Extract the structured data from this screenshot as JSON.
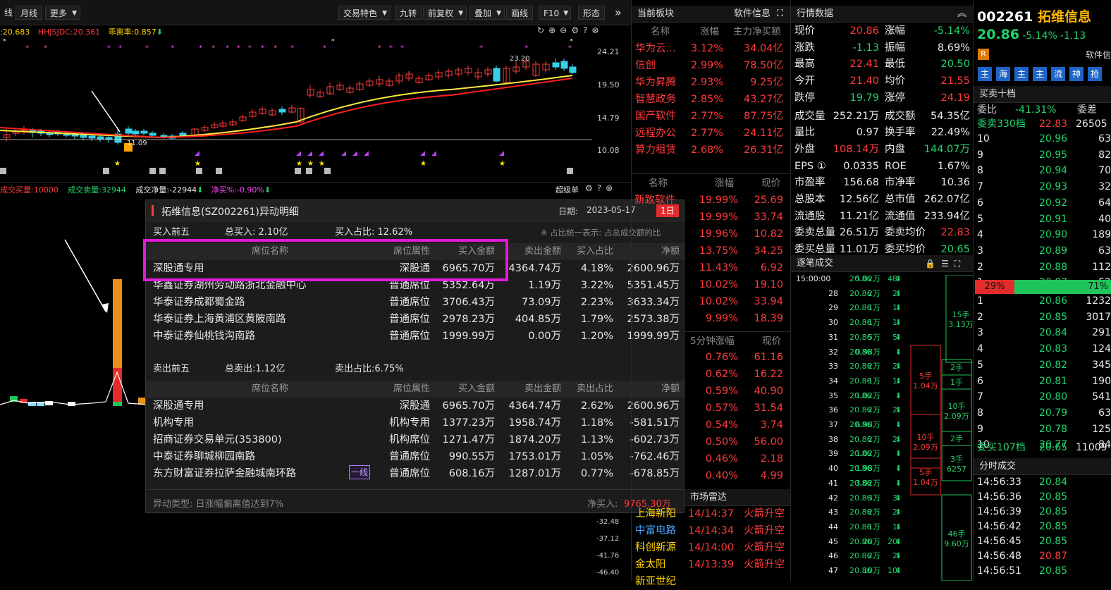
{
  "toolbar": {
    "left": [
      "线",
      "月线",
      "更多"
    ],
    "right": [
      "交易特色",
      "九转",
      "前复权",
      "叠加",
      "画线",
      "F10",
      "形态"
    ]
  },
  "indicators": {
    "main": [
      ":20.683",
      "HHJSJDC:20.361",
      "乖离率:0.857"
    ],
    "vol": [
      "成交买量:10000",
      "成交卖量:32944",
      "成交净量:-22944",
      "净买%:-0.90%"
    ],
    "vol_tag": "超级单"
  },
  "price_axis": [
    "24.21",
    "19.50",
    "14.79",
    "10.08"
  ],
  "chart_labels": {
    "high": "23.20",
    "low": "11.09"
  },
  "lower_axis": [
    "-32.48",
    "-37.12",
    "-41.76",
    "-46.40"
  ],
  "popup": {
    "title": "拓维信息(SZ002261)异动明细",
    "date_label": "日期:",
    "date": "2023-05-17",
    "period": "1日",
    "buy": {
      "section": "买入前五",
      "total": "总买入: 2.10亿",
      "ratio": "买入占比: 12.62%",
      "note": "※ 占比统一表示: 占总成交额的比"
    },
    "buy_head": [
      "席位名称",
      "席位属性",
      "买入金额",
      "卖出金额",
      "买入占比",
      "净额"
    ],
    "buy_rows": [
      [
        "深股通专用",
        "深股通",
        "6965.70万",
        "4364.74万",
        "4.18%",
        "2600.96万"
      ],
      [
        "华鑫证券湖州劳动路浙北金融中心",
        "普通席位",
        "5352.64万",
        "1.19万",
        "3.22%",
        "5351.45万"
      ],
      [
        "华泰证券成都蜀金路",
        "普通席位",
        "3706.43万",
        "73.09万",
        "2.23%",
        "3633.34万"
      ],
      [
        "华泰证券上海黄浦区黄陂南路",
        "普通席位",
        "2978.23万",
        "404.85万",
        "1.79%",
        "2573.38万"
      ],
      [
        "中泰证券仙桃钱沟南路",
        "普通席位",
        "1999.99万",
        "0.00万",
        "1.20%",
        "1999.99万"
      ]
    ],
    "sell": {
      "section": "卖出前五",
      "total": "总卖出:1.12亿",
      "ratio": "卖出占比:6.75%"
    },
    "sell_head": [
      "席位名称",
      "席位属性",
      "买入金额",
      "卖出金额",
      "卖出占比",
      "净额"
    ],
    "sell_rows": [
      [
        "深股通专用",
        "深股通",
        "6965.70万",
        "4364.74万",
        "2.62%",
        "2600.96万"
      ],
      [
        "机构专用",
        "机构专用",
        "1377.23万",
        "1958.74万",
        "1.18%",
        "-581.51万"
      ],
      [
        "招商证券交易单元(353800)",
        "机构席位",
        "1271.47万",
        "1874.20万",
        "1.13%",
        "-602.73万"
      ],
      [
        "中泰证券聊城柳园南路",
        "普通席位",
        "990.55万",
        "1753.01万",
        "1.05%",
        "-762.46万"
      ],
      [
        "东方财富证券拉萨金融城南环路",
        "普通席位",
        "608.16万",
        "1287.01万",
        "0.77%",
        "-678.85万"
      ]
    ],
    "tag": "一线",
    "footer_type": "异动类型: 日涨幅偏离值达到7%",
    "footer_net_label": "净买入:",
    "footer_net": "9765.30万"
  },
  "sector": {
    "title": "当前板块",
    "tab": "软件信息",
    "head": [
      "名称",
      "涨幅",
      "主力净买额"
    ],
    "rows": [
      [
        "华为云...",
        "3.12%",
        "34.04亿"
      ],
      [
        "信创",
        "2.99%",
        "78.50亿"
      ],
      [
        "华为昇腾",
        "2.93%",
        "9.25亿"
      ],
      [
        "智慧政务",
        "2.85%",
        "43.27亿"
      ],
      [
        "国产软件",
        "2.77%",
        "87.75亿"
      ],
      [
        "远程办公",
        "2.77%",
        "24.11亿"
      ],
      [
        "算力租赁",
        "2.68%",
        "26.31亿"
      ]
    ]
  },
  "ranking": {
    "head": [
      "名称",
      "涨幅",
      "现价"
    ],
    "first": "新致软件",
    "rows": [
      [
        "19.99%",
        "25.69"
      ],
      [
        "19.99%",
        "33.74"
      ],
      [
        "19.96%",
        "10.82"
      ],
      [
        "13.75%",
        "34.25"
      ],
      [
        "11.43%",
        "6.92"
      ],
      [
        "10.02%",
        "19.10"
      ],
      [
        "10.02%",
        "33.94"
      ],
      [
        "9.99%",
        "18.39"
      ]
    ]
  },
  "five_min": {
    "head": [
      "5分钟涨幅",
      "现价"
    ],
    "rows": [
      [
        "0.76%",
        "61.16"
      ],
      [
        "0.62%",
        "16.22"
      ],
      [
        "0.59%",
        "40.90"
      ],
      [
        "0.57%",
        "31.54"
      ],
      [
        "0.54%",
        "3.74"
      ],
      [
        "0.50%",
        "56.00"
      ],
      [
        "0.46%",
        "2.18"
      ],
      [
        "0.40%",
        "4.99"
      ]
    ]
  },
  "radar": {
    "title": "市场雷达",
    "rows": [
      [
        "上海新阳",
        "14/14:37",
        "火箭升空"
      ],
      [
        "中富电路",
        "14/14:34",
        "火箭升空"
      ],
      [
        "科创新源",
        "14/14:00",
        "火箭升空"
      ],
      [
        "金太阳",
        "14/13:39",
        "火箭升空"
      ],
      [
        "新亚世纪",
        "",
        ""
      ]
    ]
  },
  "quote": {
    "title": "行情数据",
    "rows": [
      [
        "现价",
        "20.86",
        "涨幅",
        "-5.14%"
      ],
      [
        "涨跌",
        "-1.13",
        "振幅",
        "8.69%"
      ],
      [
        "最高",
        "22.41",
        "最低",
        "20.50"
      ],
      [
        "今开",
        "21.40",
        "均价",
        "21.55"
      ],
      [
        "跌停",
        "19.79",
        "涨停",
        "24.19"
      ],
      [
        "成交量",
        "252.21万",
        "成交额",
        "54.35亿"
      ],
      [
        "量比",
        "0.97",
        "换手率",
        "22.49%"
      ],
      [
        "外盘",
        "108.14万",
        "内盘",
        "144.07万"
      ],
      [
        "EPS ①",
        "0.0335",
        "ROE",
        "1.67%"
      ],
      [
        "市盈率",
        "156.68",
        "市净率",
        "10.36"
      ],
      [
        "总股本",
        "12.56亿",
        "总市值",
        "262.07亿"
      ],
      [
        "流通股",
        "11.21亿",
        "流通值",
        "233.94亿"
      ],
      [
        "委卖总量",
        "26.51万",
        "委卖均价",
        "22.83"
      ],
      [
        "委买总量",
        "11.01万",
        "委买均价",
        "20.65"
      ]
    ]
  },
  "ticks": {
    "title": "逐笔成交",
    "rows": [
      [
        "15:00:00",
        "20.86",
        "5.02万",
        "48"
      ],
      [
        "28",
        "20.86",
        "2万",
        "2"
      ],
      [
        "29",
        "20.86",
        "1万",
        "1"
      ],
      [
        "30",
        "20.86",
        "1万",
        "1"
      ],
      [
        "31",
        "20.86",
        "5万",
        "5"
      ],
      [
        "32",
        "20.86",
        "0.98万",
        ""
      ],
      [
        "33",
        "20.86",
        "2万",
        "2"
      ],
      [
        "34",
        "20.86",
        "1万",
        "1"
      ],
      [
        "35",
        "20.86",
        "1.02万",
        ""
      ],
      [
        "36",
        "20.86",
        "2万",
        "2"
      ],
      [
        "37",
        "20.86",
        "6.98万",
        ""
      ],
      [
        "38",
        "20.86",
        "2万",
        "2"
      ],
      [
        "39",
        "20.86",
        "1.02万",
        ""
      ],
      [
        "40",
        "20.86",
        "1.98万",
        ""
      ],
      [
        "41",
        "20.86",
        "3.02万",
        ""
      ],
      [
        "42",
        "20.86",
        "3万",
        "3"
      ],
      [
        "43",
        "20.86",
        "2万",
        "2"
      ],
      [
        "44",
        "20.86",
        "1万",
        "1"
      ],
      [
        "45",
        "20.86",
        "20万",
        "20"
      ],
      [
        "46",
        "20.86",
        "2万",
        "2"
      ],
      [
        "47",
        "20.86",
        "10万",
        "10"
      ]
    ],
    "boxes": [
      [
        "15手",
        "3.13万"
      ],
      [
        "5手",
        "1.04万"
      ],
      [
        "2手"
      ],
      [
        "1手"
      ],
      [
        "10手",
        "2.09万"
      ],
      [
        "10手",
        "2.09万"
      ],
      [
        "2手"
      ],
      [
        "3手",
        "6257"
      ],
      [
        "5手",
        "1.04万"
      ],
      [
        "46手",
        "9.60万"
      ]
    ]
  },
  "stock": {
    "code": "002261",
    "name": "拓维信息",
    "price": "20.86",
    "chg_pct": "-5.14%",
    "chg": "-1.13",
    "badge": "R",
    "sector_tab": "软件信",
    "tabs": [
      "主",
      "海",
      "主",
      "主",
      "流",
      "神",
      "抢"
    ]
  },
  "orderbook": {
    "title": "买卖十档",
    "ratio_label": "委比",
    "ratio": "-41.31%",
    "diff_label": "委差",
    "sell_summary": [
      "委卖330档",
      "22.83",
      "26505"
    ],
    "sell": [
      [
        "10",
        "20.96",
        "63"
      ],
      [
        "9",
        "20.95",
        "82"
      ],
      [
        "8",
        "20.94",
        "70"
      ],
      [
        "7",
        "20.93",
        "32"
      ],
      [
        "6",
        "20.92",
        "64"
      ],
      [
        "5",
        "20.91",
        "40"
      ],
      [
        "4",
        "20.90",
        "189"
      ],
      [
        "3",
        "20.89",
        "63"
      ],
      [
        "2",
        "20.88",
        "112"
      ],
      [
        "1",
        "20.87",
        "52"
      ]
    ],
    "buy_pct": 29,
    "sell_pct": 71,
    "buy_pct_label": "29%",
    "sell_pct_label": "71%",
    "buy": [
      [
        "1",
        "20.86",
        "1232"
      ],
      [
        "2",
        "20.85",
        "3017"
      ],
      [
        "3",
        "20.84",
        "291"
      ],
      [
        "4",
        "20.83",
        "124"
      ],
      [
        "5",
        "20.82",
        "345"
      ],
      [
        "6",
        "20.81",
        "190"
      ],
      [
        "7",
        "20.80",
        "541"
      ],
      [
        "8",
        "20.79",
        "63"
      ],
      [
        "9",
        "20.78",
        "125"
      ],
      [
        "10",
        "20.77",
        "84"
      ]
    ],
    "buy_summary": [
      "委买107档",
      "20.65",
      "11009"
    ]
  },
  "time_sales": {
    "title": "分时成交",
    "rows": [
      [
        "14:56:33",
        "20.84"
      ],
      [
        "14:56:36",
        "20.85"
      ],
      [
        "14:56:39",
        "20.85"
      ],
      [
        "14:56:42",
        "20.85"
      ],
      [
        "14:56:45",
        "20.85"
      ],
      [
        "14:56:48",
        "20.87"
      ],
      [
        "14:56:51",
        "20.85"
      ]
    ]
  }
}
